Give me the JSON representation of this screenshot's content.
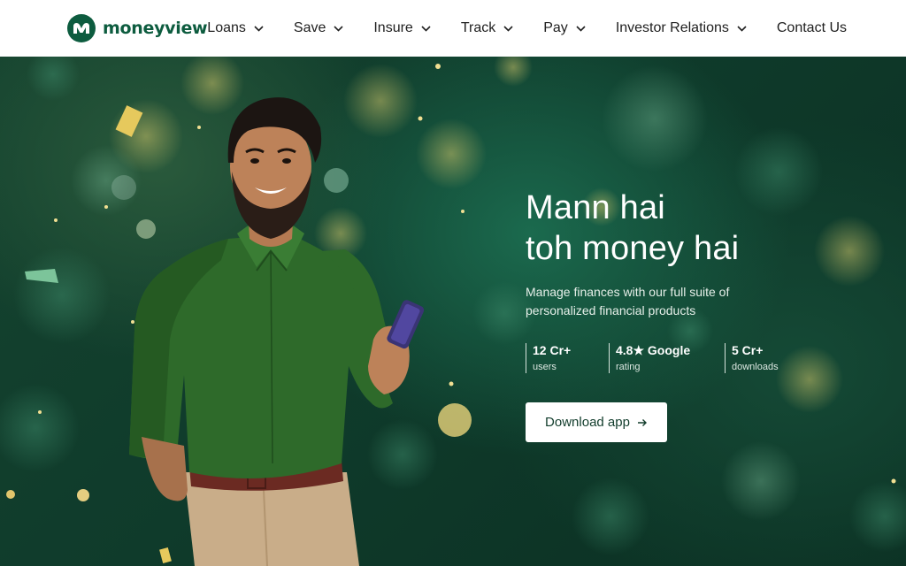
{
  "brand": {
    "name": "moneyview",
    "logo_icon": "moneyview-logo-icon",
    "color": "#0d5c3f"
  },
  "nav": {
    "items": [
      {
        "label": "Loans",
        "has_dropdown": true
      },
      {
        "label": "Save",
        "has_dropdown": true
      },
      {
        "label": "Insure",
        "has_dropdown": true
      },
      {
        "label": "Track",
        "has_dropdown": true
      },
      {
        "label": "Pay",
        "has_dropdown": true
      },
      {
        "label": "Investor Relations",
        "has_dropdown": true
      },
      {
        "label": "Contact Us",
        "has_dropdown": false
      }
    ]
  },
  "hero": {
    "headline_line1": "Mann hai",
    "headline_line2": "toh money hai",
    "subtext": "Manage finances with our full suite of personalized financial products",
    "stats": [
      {
        "value": "12 Cr+",
        "label": "users"
      },
      {
        "value": "4.8★ Google",
        "label": "rating"
      },
      {
        "value": "5 Cr+",
        "label": "downloads"
      }
    ],
    "cta_label": "Download app",
    "cta_icon": "arrow-right-icon",
    "background_color": "#0f3b2b"
  }
}
